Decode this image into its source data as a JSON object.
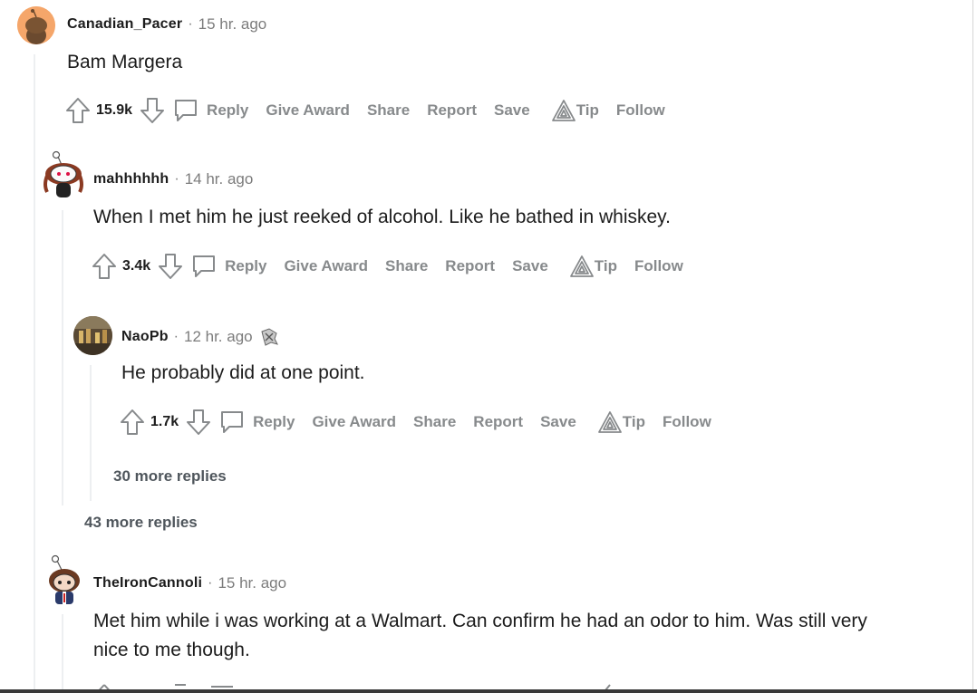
{
  "comments": [
    {
      "username": "Canadian_Pacer",
      "separator": "·",
      "time": "15 hr. ago",
      "body": "Bam Margera",
      "score": "15.9k",
      "actions": {
        "reply": "Reply",
        "give_award": "Give Award",
        "share": "Share",
        "report": "Report",
        "save": "Save",
        "tip": "Tip",
        "follow": "Follow"
      }
    },
    {
      "username": "mahhhhhh",
      "separator": "·",
      "time": "14 hr. ago",
      "body": "When I met him he just reeked of alcohol. Like he bathed in whiskey.",
      "score": "3.4k",
      "actions": {
        "reply": "Reply",
        "give_award": "Give Award",
        "share": "Share",
        "report": "Report",
        "save": "Save",
        "tip": "Tip",
        "follow": "Follow"
      }
    },
    {
      "username": "NaoPb",
      "separator": "·",
      "time": "12 hr. ago",
      "body": "He probably did at one point.",
      "score": "1.7k",
      "actions": {
        "reply": "Reply",
        "give_award": "Give Award",
        "share": "Share",
        "report": "Report",
        "save": "Save",
        "tip": "Tip",
        "follow": "Follow"
      }
    },
    {
      "username": "TheIronCannoli",
      "separator": "·",
      "time": "15 hr. ago",
      "body": "Met him while i was working at a Walmart. Can confirm he had an odor to him. Was still very nice to me though."
    }
  ],
  "more_replies": {
    "inner": "30 more replies",
    "outer": "43 more replies"
  },
  "colors": {
    "accent_orange": "#f5a66a",
    "action_gray": "#878a8c",
    "thread_line": "#edeff1"
  },
  "icons": [
    "upvote-icon",
    "downvote-icon",
    "comment-bubble-icon",
    "tip-triangle-icon",
    "award-badge-icon"
  ]
}
